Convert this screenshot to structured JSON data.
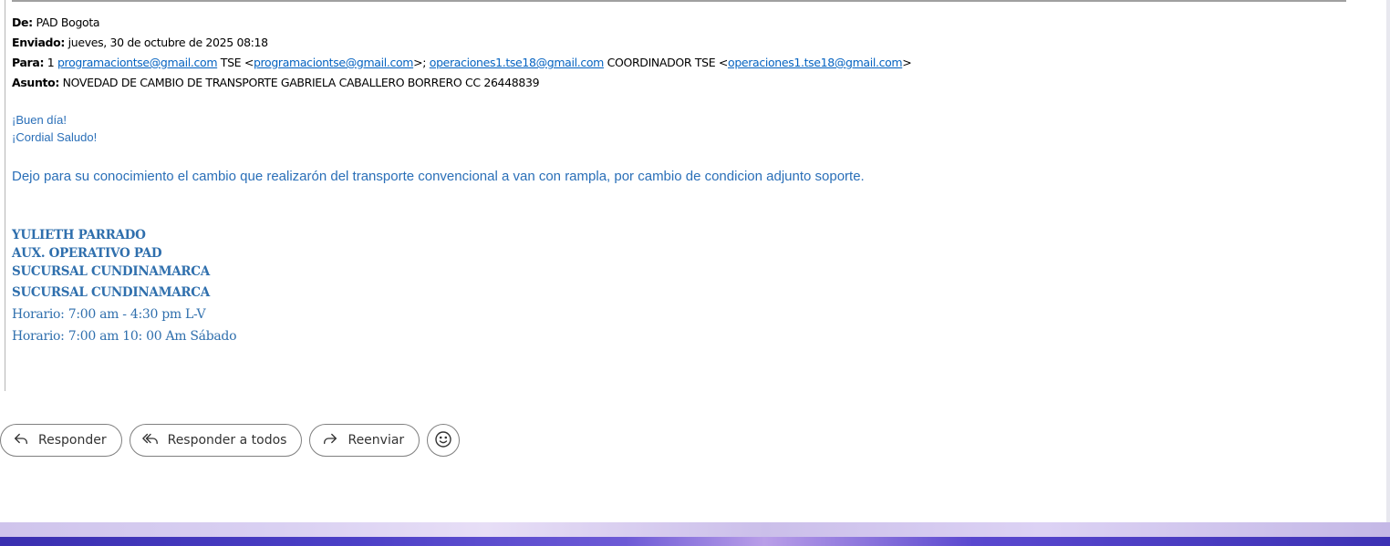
{
  "header": {
    "from_label": "De:",
    "from_value": "PAD Bogota",
    "sent_label": "Enviado:",
    "sent_value": "jueves, 30 de octubre de 2025 08:18",
    "to_label": "Para:",
    "to_prefix": "1",
    "to_link1": "programaciontse@gmail.com",
    "to_mid1": "TSE <",
    "to_link2": "programaciontse@gmail.com",
    "to_mid2": ">;",
    "to_link3": "operaciones1.tse18@gmail.com",
    "to_mid3": "COORDINADOR TSE <",
    "to_link4": "operaciones1.tse18@gmail.com",
    "to_end": ">",
    "subject_label": "Asunto:",
    "subject_value": "NOVEDAD DE CAMBIO DE TRANSPORTE GABRIELA CABALLERO BORRERO CC 26448839"
  },
  "body": {
    "greeting1": "¡Buen día!",
    "greeting2": "¡Cordial Saludo!",
    "text": "Dejo para su conocimiento el cambio que realizarón del transporte convencional  a van con rampla, por cambio de condicion adjunto soporte."
  },
  "signature": {
    "name": "YULIETH PARRADO",
    "role": "AUX. OPERATIVO  PAD",
    "branch1": "SUCURSAL CUNDINAMARCA",
    "branch2": "SUCURSAL CUNDINAMARCA",
    "hours1": "Horario: 7:00 am - 4:30 pm  L-V",
    "hours2": "Horario: 7:00 am 10: 00 Am  Sábado"
  },
  "actions": {
    "reply_label": "Responder",
    "reply_all_label": "Responder a todos",
    "forward_label": "Reenviar"
  },
  "colors": {
    "link": "#0563c1",
    "body_text": "#2a6fb8",
    "signature": "#2f6fad"
  },
  "icons": [
    "reply-icon",
    "reply-all-icon",
    "forward-icon",
    "smiley-icon"
  ]
}
